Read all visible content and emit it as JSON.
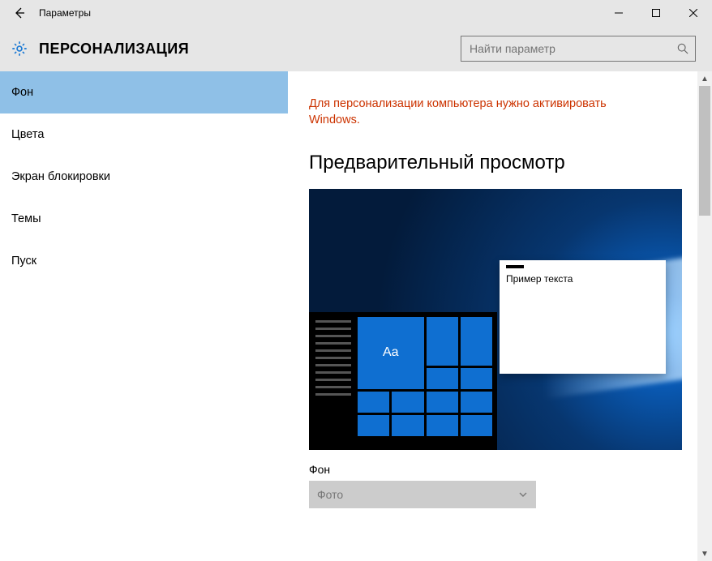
{
  "window": {
    "title": "Параметры"
  },
  "header": {
    "section": "ПЕРСОНАЛИЗАЦИЯ"
  },
  "search": {
    "placeholder": "Найти параметр"
  },
  "sidebar": {
    "items": [
      {
        "label": "Фон",
        "active": true
      },
      {
        "label": "Цвета"
      },
      {
        "label": "Экран блокировки"
      },
      {
        "label": "Темы"
      },
      {
        "label": "Пуск"
      }
    ]
  },
  "content": {
    "activation_warning": "Для персонализации компьютера нужно активировать Windows.",
    "preview_heading": "Предварительный просмотр",
    "sample_text": "Пример текста",
    "tile_label": "Aa",
    "background_label": "Фон",
    "background_value": "Фото"
  }
}
